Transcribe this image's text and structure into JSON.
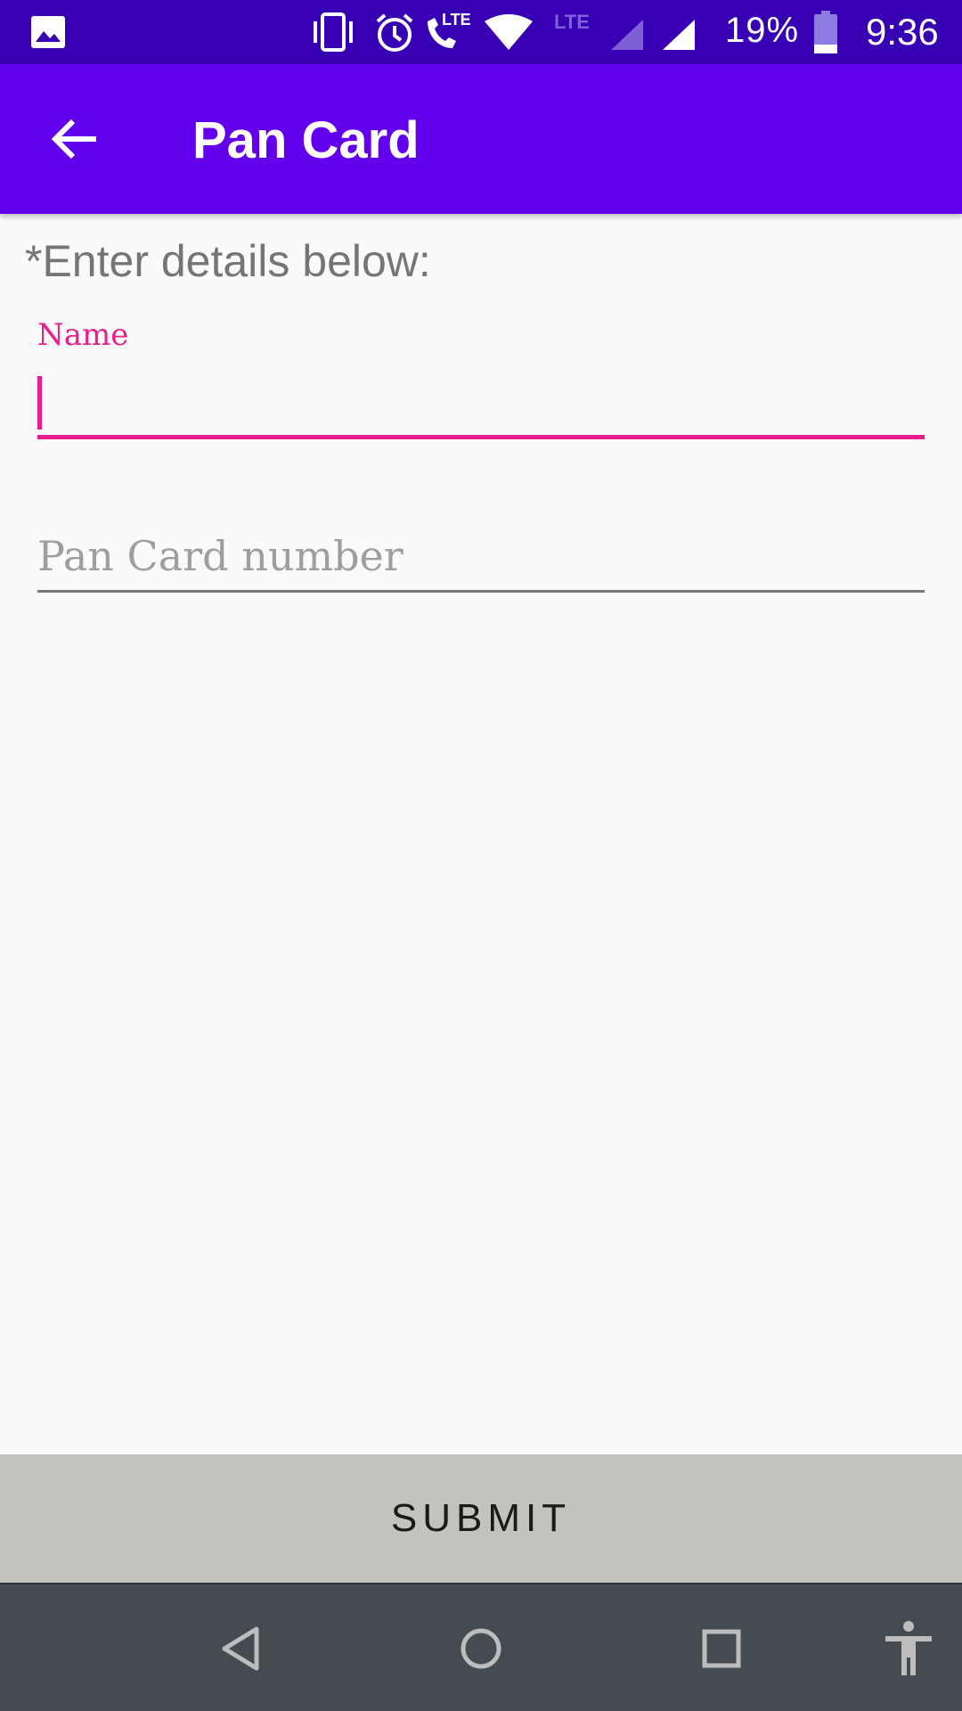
{
  "status_bar": {
    "battery_percent": "19%",
    "time": "9:36",
    "icons": [
      "gallery-icon",
      "vibrate-icon",
      "alarm-icon",
      "lte-call-icon",
      "wifi-icon",
      "lte-icon",
      "signal-icon",
      "signal-icon",
      "battery-icon"
    ]
  },
  "app_bar": {
    "title": "Pan Card",
    "back_icon": "arrow-left-icon"
  },
  "form": {
    "instructions": "*Enter details below:",
    "name": {
      "label": "Name",
      "value": "",
      "focused": true
    },
    "pan": {
      "placeholder": "Pan Card number",
      "value": ""
    }
  },
  "submit": {
    "label": "SUBMIT"
  },
  "nav_bar": {
    "buttons": [
      "back-icon",
      "home-icon",
      "recents-icon",
      "accessibility-icon"
    ]
  },
  "colors": {
    "status_bar": "#3700b3",
    "app_bar": "#6200ee",
    "accent": "#e91e8c",
    "submit_bg": "#c3c2bd",
    "nav_bar": "#444b51"
  }
}
